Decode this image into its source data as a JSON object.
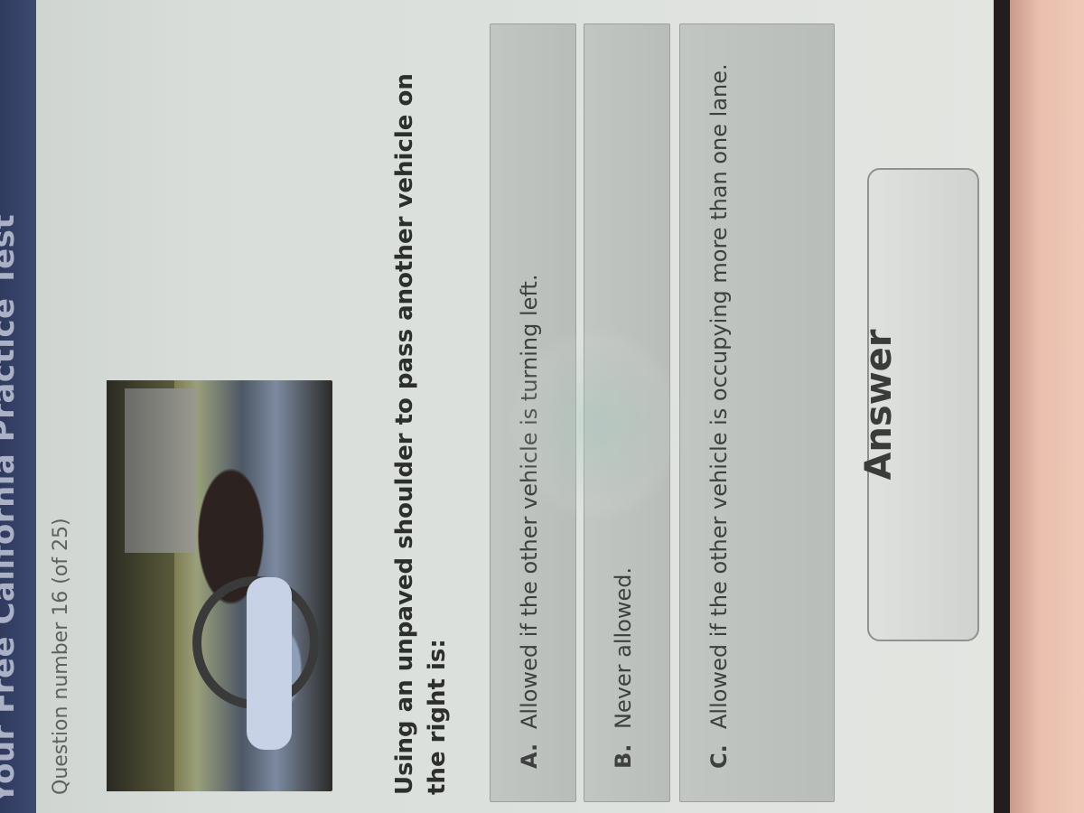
{
  "header": {
    "title": "Your Free California Practice Test"
  },
  "question": {
    "number_label": "Question number 16 (of 25)",
    "text": "Using an unpaved shoulder to pass another vehicle on the right is:"
  },
  "options": [
    {
      "letter": "A.",
      "text": "Allowed if the other vehicle is turning left."
    },
    {
      "letter": "B.",
      "text": "Never allowed."
    },
    {
      "letter": "C.",
      "text": "Allowed if the other vehicle is occupying more than one lane."
    }
  ],
  "answer_button": {
    "label": "Answer"
  },
  "colors": {
    "header_bg": "#2f3a5e",
    "option_bg": "#c2c6c2",
    "screen_bg": "#dde1dd"
  }
}
